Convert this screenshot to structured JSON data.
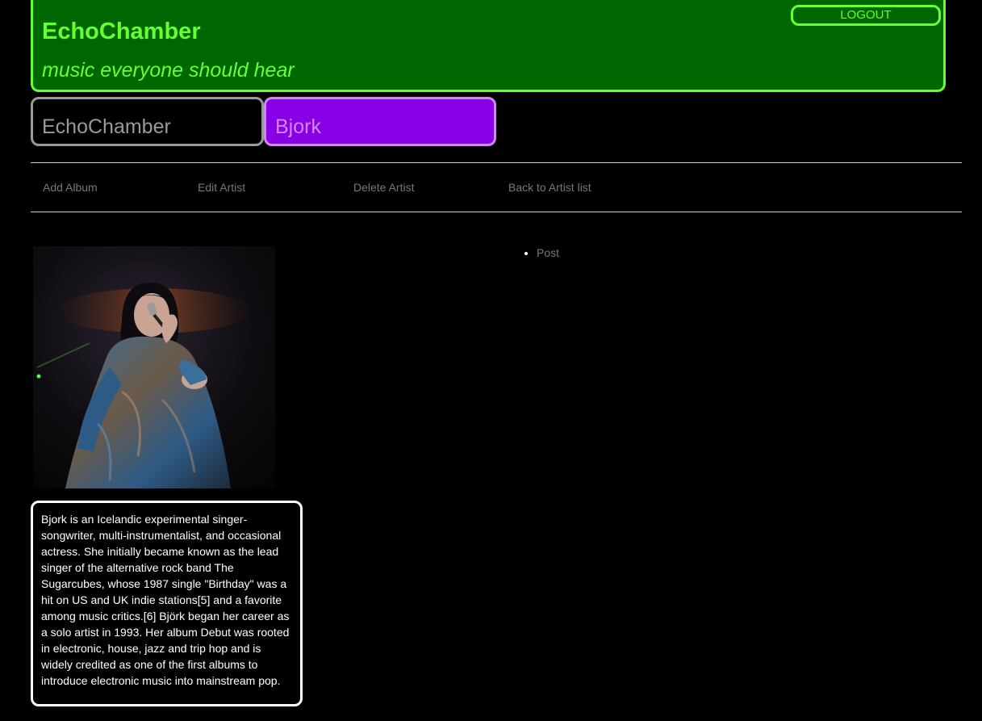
{
  "header": {
    "title": "EchoChamber",
    "tagline": "music everyone should hear",
    "logout_label": "LOGOUT"
  },
  "breadcrumb": {
    "home_label": "EchoChamber",
    "artist_label": "Bjork"
  },
  "actions": {
    "add_album": "Add Album",
    "edit_artist": "Edit Artist",
    "delete_artist": "Delete Artist",
    "back_to_list": "Back to Artist list"
  },
  "artist": {
    "photo_icon": "artist-photo",
    "bio": "Bjork is an Icelandic experimental singer-songwriter, multi-instrumentalist, and occasional actress. She initially became known as the lead singer of the alternative rock band The Sugarcubes, whose 1987 single \"Birthday\" was a hit on US and UK indie stations[5] and a favorite among music critics.[6] Björk began her career as a solo artist in 1993. Her album Debut was rooted in electronic, house, jazz and trip hop and is widely credited as one of the first albums to introduce electronic music into mainstream pop."
  },
  "posts": {
    "items": [
      {
        "label": "Post"
      }
    ]
  },
  "colors": {
    "header_bg": "#006600",
    "header_accent": "#66ff33",
    "artist_tab_bg": "#8a00e6",
    "artist_tab_fg": "#cf88f0",
    "home_tab_fg": "#9a9a9a",
    "link_gray": "#777777"
  }
}
